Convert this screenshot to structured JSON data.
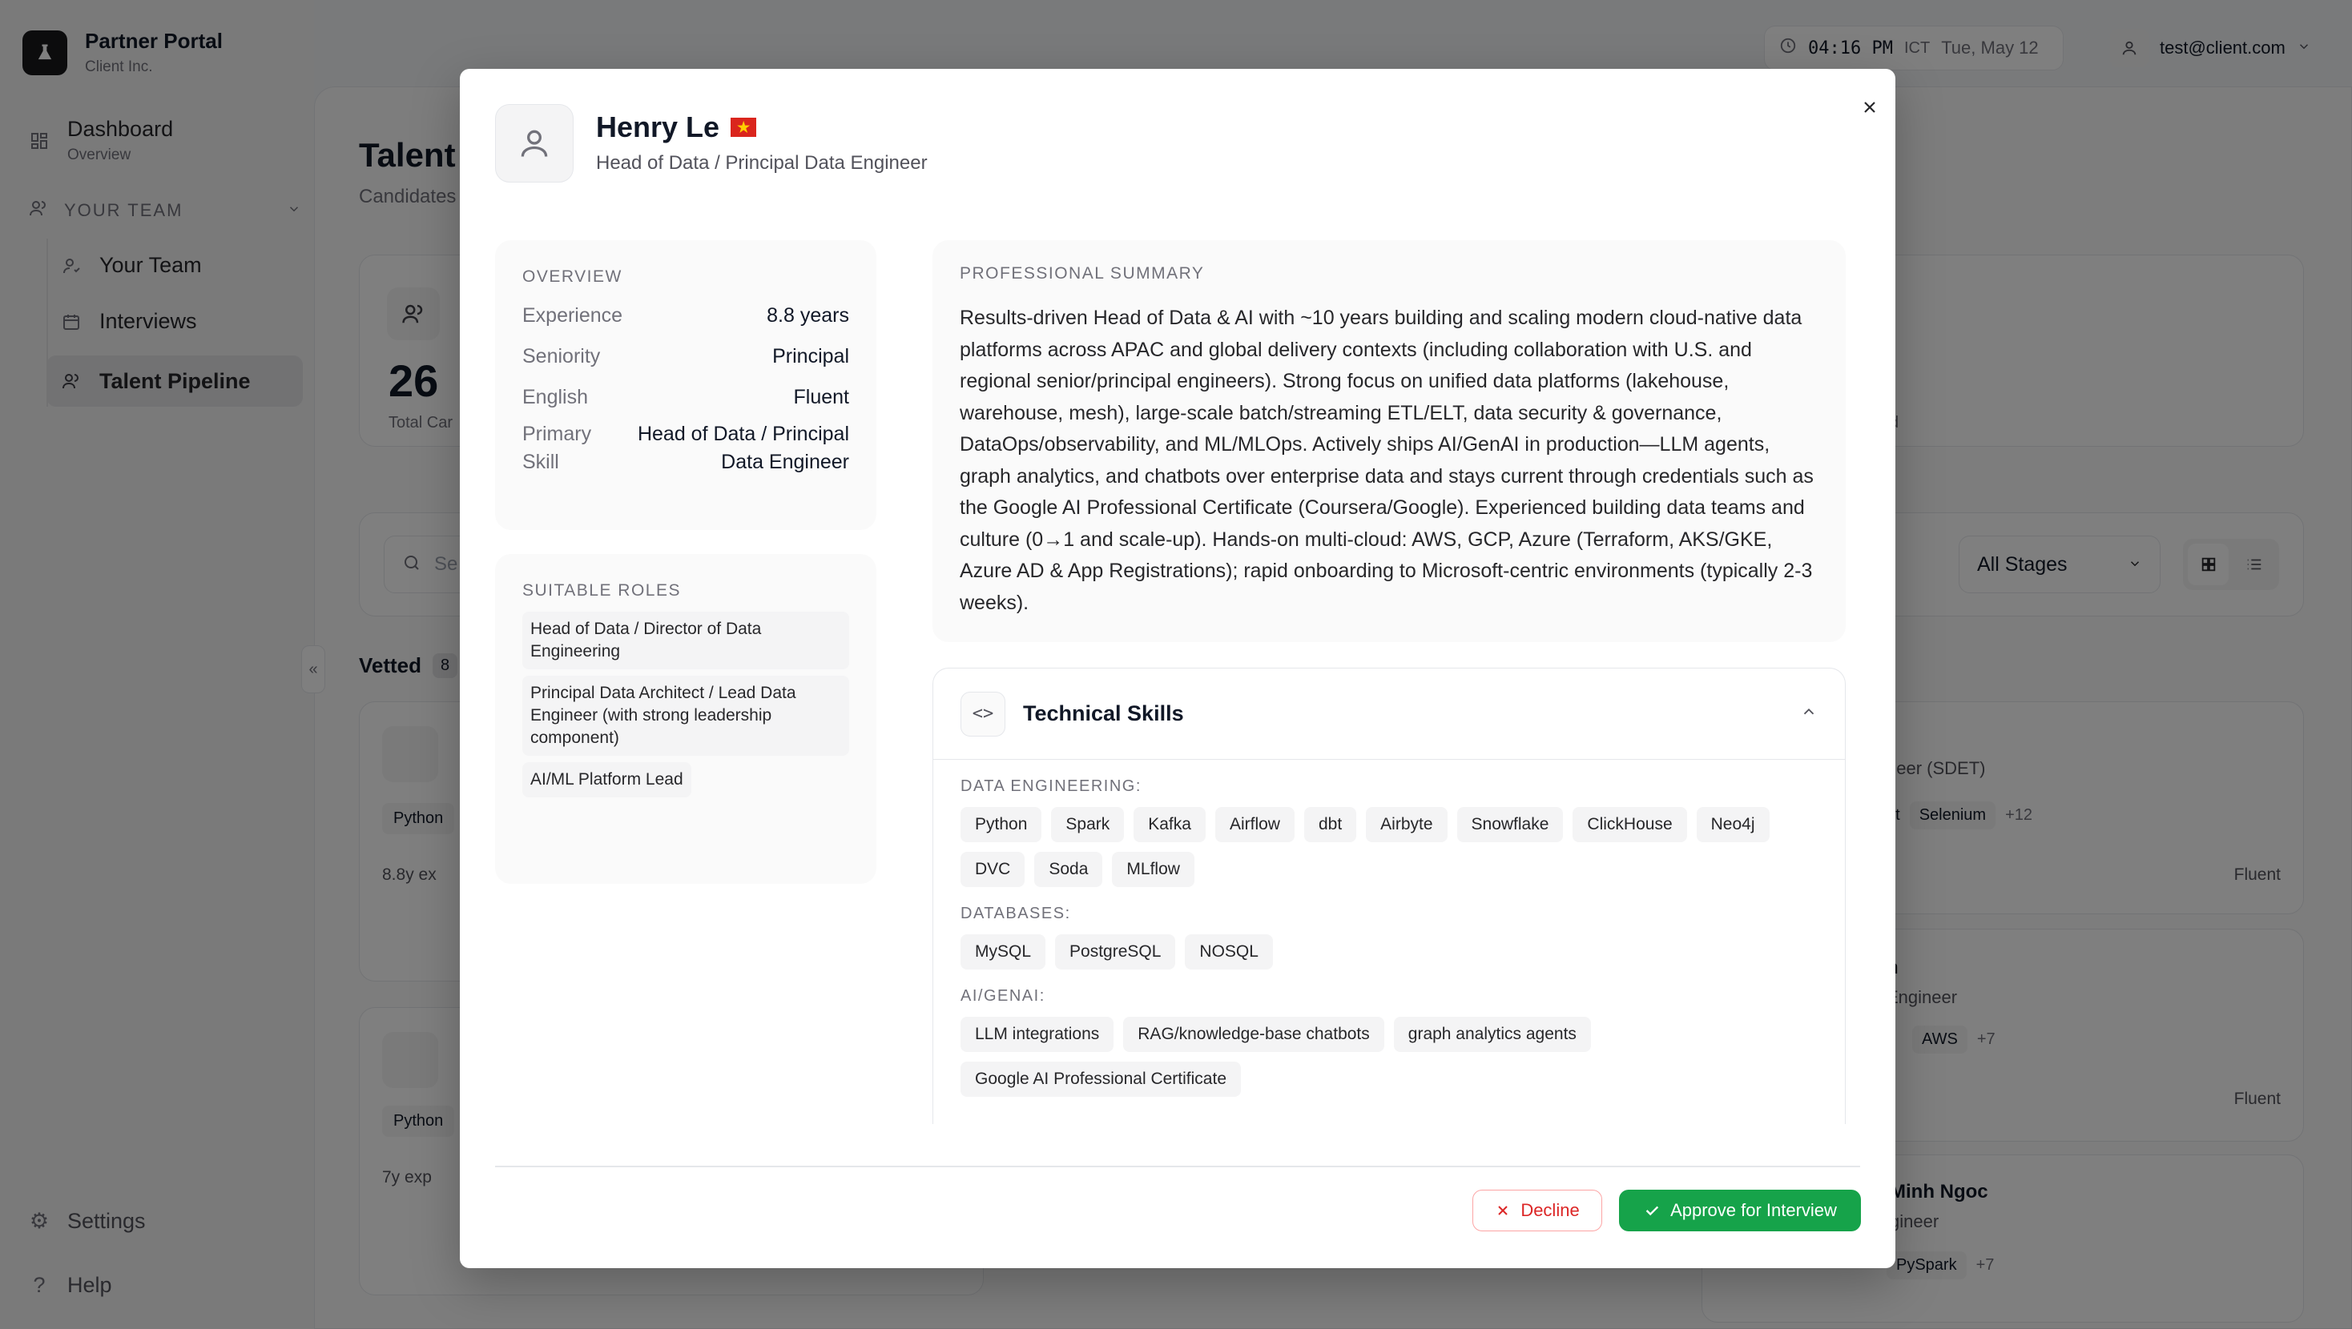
{
  "app": {
    "title": "Partner Portal",
    "subtitle": "Client Inc."
  },
  "sidebar": {
    "dashboard": {
      "label": "Dashboard",
      "sub": "Overview"
    },
    "section": "YOUR TEAM",
    "items": [
      {
        "label": "Your Team",
        "icon": "user-icon"
      },
      {
        "label": "Interviews",
        "icon": "calendar-icon"
      },
      {
        "label": "Talent Pipeline",
        "icon": "users-icon"
      }
    ],
    "settings": "Settings",
    "help": "Help"
  },
  "header": {
    "time": "04:16 PM",
    "tz": "ICT",
    "date": "Tue, May 12",
    "user": "test@client.com"
  },
  "background": {
    "title": "Talent",
    "subtitle": "Candidates",
    "stat_value": "26",
    "stat_label": "Total Car",
    "search_placeholder": "Se",
    "stage_filter": "All Stages",
    "vetted": "Vetted",
    "vetted_count": "8",
    "card_chip_1": "Python",
    "card_exp_1": "8.8y ex",
    "card_chip_2": "Python",
    "card_exp_2": "7y exp",
    "right_role_1": "neer (SDET)",
    "right_chip_1a": "pt",
    "right_chip_1b": "Selenium",
    "right_more_1": "+12",
    "right_fluent_1": "Fluent",
    "right_name_2": "n",
    "right_role_2": "Engineer",
    "right_chip_2": "AWS",
    "right_more_2": "+7",
    "right_fluent_2": "Fluent",
    "right_name_3": "Minh Ngoc",
    "right_role_3": "gineer",
    "right_chip_3": "PySpark",
    "right_more_3": "+7",
    "stat_right_label": "d"
  },
  "modal": {
    "name": "Henry Le",
    "role": "Head of Data / Principal Data Engineer",
    "overview": {
      "label": "OVERVIEW",
      "rows": [
        {
          "key": "Experience",
          "value": "8.8 years"
        },
        {
          "key": "Seniority",
          "value": "Principal"
        },
        {
          "key": "English",
          "value": "Fluent"
        },
        {
          "key": "Primary Skill",
          "value": "Head of Data / Principal Data Engineer"
        }
      ]
    },
    "suitable_roles": {
      "label": "SUITABLE ROLES",
      "items": [
        "Head of Data / Director of Data Engineering",
        "Principal Data Architect / Lead Data Engineer (with strong leadership component)",
        "AI/ML Platform Lead"
      ]
    },
    "summary": {
      "label": "PROFESSIONAL SUMMARY",
      "text": "Results-driven Head of Data & AI with ~10 years building and scaling modern cloud-native data platforms across APAC and global delivery contexts (including collaboration with U.S. and regional senior/principal engineers). Strong focus on unified data platforms (lakehouse, warehouse, mesh), large-scale batch/streaming ETL/ELT, data security & governance, DataOps/observability, and ML/MLOps. Actively ships AI/GenAI in production—LLM agents, graph analytics, and chatbots over enterprise data and stays current through credentials such as the Google AI Professional Certificate (Coursera/Google). Experienced building data teams and culture (0→1 and scale-up). Hands-on multi-cloud: AWS, GCP, Azure (Terraform, AKS/GKE, Azure AD & App Registrations); rapid onboarding to Microsoft-centric environments (typically 2-3 weeks)."
    },
    "skills": {
      "title": "Technical Skills",
      "categories": [
        {
          "label": "DATA ENGINEERING:",
          "chips": [
            "Python",
            "Spark",
            "Kafka",
            "Airflow",
            "dbt",
            "Airbyte",
            "Snowflake",
            "ClickHouse",
            "Neo4j",
            "DVC",
            "Soda",
            "MLflow"
          ]
        },
        {
          "label": "DATABASES:",
          "chips": [
            "MySQL",
            "PostgreSQL",
            "NOSQL"
          ]
        },
        {
          "label": "AI/GENAI:",
          "chips": [
            "LLM integrations",
            "RAG/knowledge-base chatbots",
            "graph analytics agents",
            "Google AI Professional Certificate"
          ]
        }
      ]
    },
    "actions": {
      "decline": "Decline",
      "approve": "Approve for Interview"
    }
  },
  "colors": {
    "approve": "#16a34a",
    "decline": "#dc2626",
    "overlay": "rgba(0,0,0,0.5)"
  }
}
